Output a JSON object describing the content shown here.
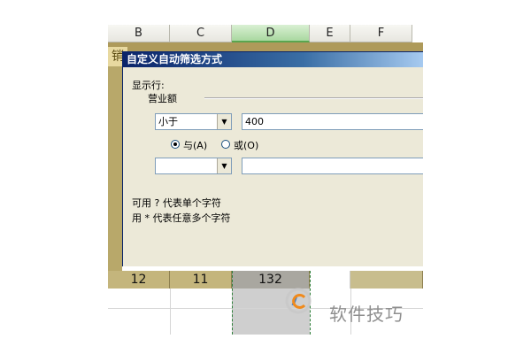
{
  "sheet": {
    "columns": [
      "B",
      "C",
      "D",
      "E",
      "F"
    ],
    "selected_column": "D",
    "left_cell_text": "销",
    "row_values": [
      "12",
      "11",
      "132"
    ]
  },
  "dialog": {
    "title": "自定义自动筛选方式",
    "show_rows_label": "显示行:",
    "field_label": "营业额",
    "condition1": {
      "operator": "小于",
      "value": "400"
    },
    "logic": {
      "and_label": "与(A)",
      "or_label": "或(O)",
      "selected": "and"
    },
    "condition2": {
      "operator": "",
      "value": ""
    },
    "hint1": "可用 ? 代表单个字符",
    "hint2": "用 * 代表任意多个字符"
  },
  "watermark": {
    "text": "软件技巧"
  }
}
